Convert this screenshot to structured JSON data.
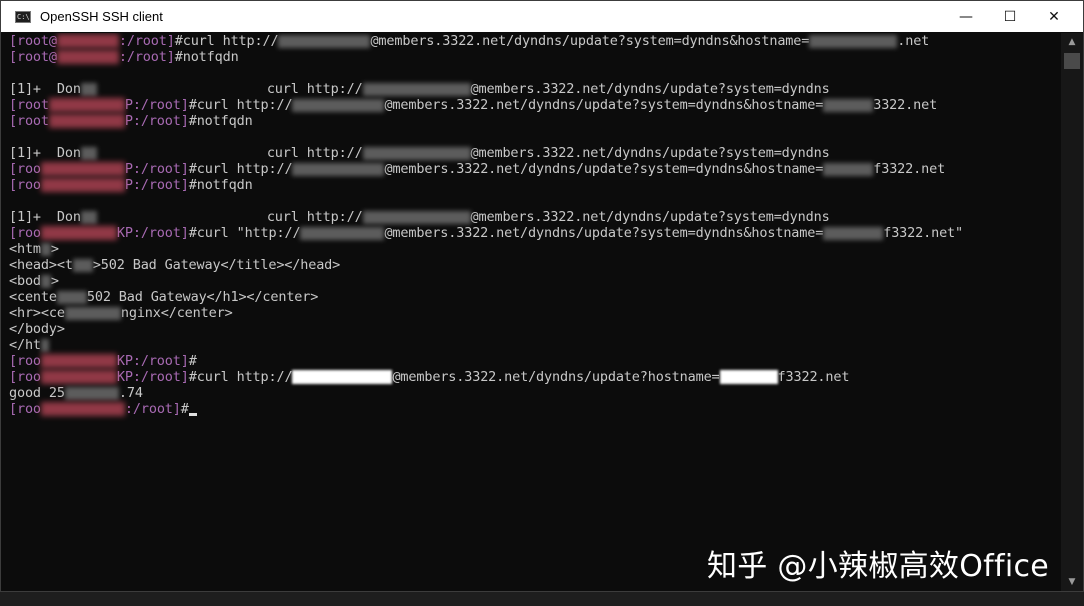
{
  "window": {
    "title": "OpenSSH SSH client",
    "controls": {
      "minimize": "—",
      "maximize": "☐",
      "close": "✕"
    }
  },
  "terminal": {
    "lines": [
      {
        "prompt": "[root@",
        "host_tail": ":/root]",
        "cmd": "#curl http://",
        "cmd2": "@members.3322.net/dyndns/update?system=dyndns&hostname=",
        "cmd3": ".net"
      },
      {
        "prompt": "[root@",
        "host_tail": ":/root]",
        "cmd": "#notfqdn"
      },
      {
        "text": ""
      },
      {
        "text": "[1]+  Don",
        "text2": "curl http://",
        "text3": "@members.3322.net/dyndns/update?system=dyndns"
      },
      {
        "prompt": "[root",
        "host_tail": "P:/root]",
        "cmd": "#curl http://",
        "cmd2": "@members.3322.net/dyndns/update?system=dyndns&hostname=",
        "cmd3": "3322.net"
      },
      {
        "prompt": "[root",
        "host_tail": "P:/root]",
        "cmd": "#notfqdn"
      },
      {
        "text": ""
      },
      {
        "text": "[1]+  Don",
        "text2": "curl http://",
        "text3": "@members.3322.net/dyndns/update?system=dyndns"
      },
      {
        "prompt": "[roo",
        "host_tail": "P:/root]",
        "cmd": "#curl http://",
        "cmd2": "@members.3322.net/dyndns/update?system=dyndns&hostname=",
        "cmd3": "f3322.net"
      },
      {
        "prompt": "[roo",
        "host_tail": "P:/root]",
        "cmd": "#notfqdn"
      },
      {
        "text": ""
      },
      {
        "text": "[1]+  Don",
        "text2": "curl http://",
        "text3": "@members.3322.net/dyndns/update?system=dyndns"
      },
      {
        "prompt": "[roo",
        "host_tail": "KP:/root]",
        "cmd": "#curl \"http://",
        "cmd2": "@members.3322.net/dyndns/update?system=dyndns&hostname=",
        "cmd3": "f3322.net\""
      },
      {
        "text": "<htm",
        "text2": ">"
      },
      {
        "text": "<head><t",
        "text2": ">502 Bad Gateway</title></head>"
      },
      {
        "text": "<bod",
        "text2": ">"
      },
      {
        "text": "<cente",
        "text2": "502 Bad Gateway</h1></center>"
      },
      {
        "text": "<hr><ce",
        "text2": "nginx</center>"
      },
      {
        "text": "</body>"
      },
      {
        "text": "</ht",
        "text2": ""
      },
      {
        "prompt": "[roo",
        "host_tail": "KP:/root]",
        "cmd": "#"
      },
      {
        "prompt": "[roo",
        "host_tail": "KP:/root]",
        "cmd": "#curl http://",
        "cmd2": "@members.3322.net/dyndns/update?hostname=",
        "cmd3": "f3322.net"
      },
      {
        "text": "good 25",
        "text2": ".74"
      },
      {
        "prompt": "[roo",
        "host_tail": ":/root]",
        "cmd": "#"
      }
    ]
  },
  "watermark": "知乎 @小辣椒高效Office"
}
